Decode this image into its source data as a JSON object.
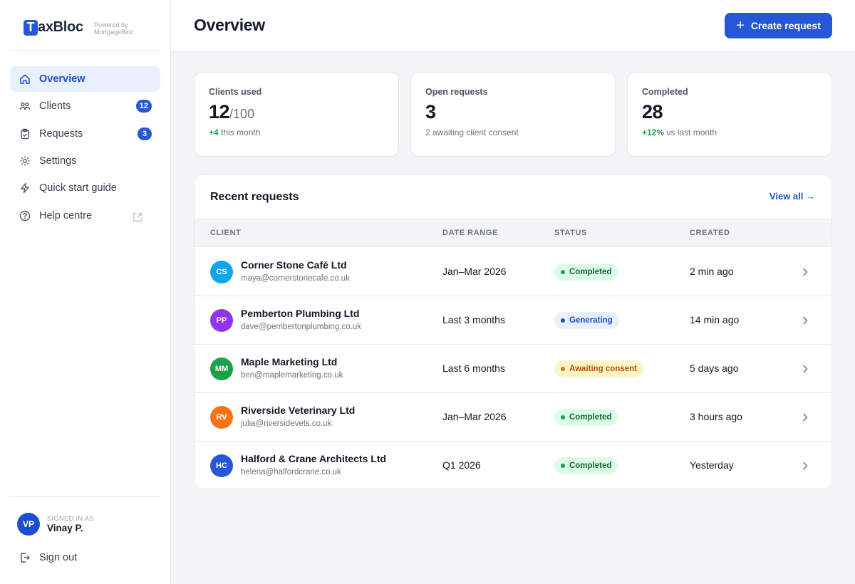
{
  "brand": {
    "mark": "T",
    "name": "axBloc",
    "powered_line1": "Powered by",
    "powered_line2": "MortgageBloc"
  },
  "nav": {
    "items": [
      {
        "label": "Overview",
        "icon": "home-icon",
        "active": true
      },
      {
        "label": "Clients",
        "icon": "clients-icon",
        "badge": "12"
      },
      {
        "label": "Requests",
        "icon": "clipboard-icon",
        "badge": "3"
      },
      {
        "label": "Settings",
        "icon": "gear-icon"
      },
      {
        "label": "Quick start guide",
        "icon": "bolt-icon"
      },
      {
        "label": "Help centre",
        "icon": "help-icon",
        "external": true
      }
    ]
  },
  "user": {
    "initials": "VP",
    "signed_label": "SIGNED IN AS",
    "name": "Vinay P."
  },
  "signout": {
    "label": "Sign out"
  },
  "header": {
    "title": "Overview",
    "create_label": "Create request"
  },
  "stats": [
    {
      "label": "Clients used",
      "value": "12",
      "of": "/100",
      "sub_highlight": "+4",
      "sub_text": " this month"
    },
    {
      "label": "Open requests",
      "value": "3",
      "sub_text": "2 awaiting client consent"
    },
    {
      "label": "Completed",
      "value": "28",
      "sub_highlight": "+12%",
      "sub_text": " vs last month"
    }
  ],
  "recent": {
    "title": "Recent requests",
    "view_all": "View all →",
    "columns": {
      "client": "CLIENT",
      "date_range": "DATE RANGE",
      "status": "STATUS",
      "created": "CREATED"
    },
    "rows": [
      {
        "initials": "CS",
        "avatar_color": "#0ea5e9",
        "name": "Corner Stone Café Ltd",
        "email": "maya@cornerstonecafe.co.uk",
        "range": "Jan–Mar 2026",
        "status": "Completed",
        "status_kind": "completed",
        "created": "2 min ago"
      },
      {
        "initials": "PP",
        "avatar_color": "#9333ea",
        "name": "Pemberton Plumbing Ltd",
        "email": "dave@pembertonplumbing.co.uk",
        "range": "Last 3 months",
        "status": "Generating",
        "status_kind": "generating",
        "created": "14 min ago"
      },
      {
        "initials": "MM",
        "avatar_color": "#16a34a",
        "name": "Maple Marketing Ltd",
        "email": "ben@maplemarketing.co.uk",
        "range": "Last 6 months",
        "status": "Awaiting consent",
        "status_kind": "awaiting",
        "created": "5 days ago"
      },
      {
        "initials": "RV",
        "avatar_color": "#f97316",
        "name": "Riverside Veterinary Ltd",
        "email": "julia@riversidevets.co.uk",
        "range": "Jan–Mar 2026",
        "status": "Completed",
        "status_kind": "completed",
        "created": "3 hours ago"
      },
      {
        "initials": "HC",
        "avatar_color": "#2557d6",
        "name": "Halford & Crane Architects Ltd",
        "email": "helena@halfordcrane.co.uk",
        "range": "Q1 2026",
        "status": "Completed",
        "status_kind": "completed",
        "created": "Yesterday"
      }
    ]
  }
}
